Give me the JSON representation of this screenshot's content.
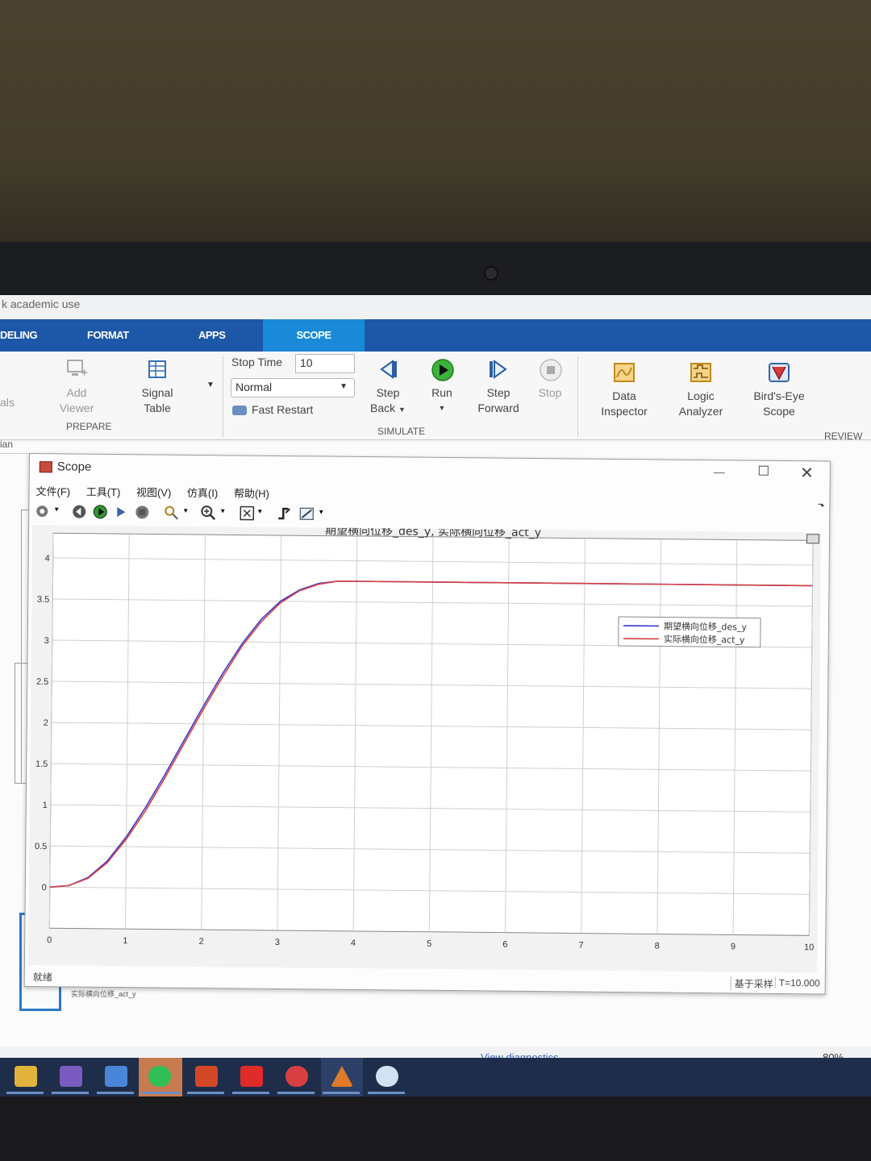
{
  "app": {
    "title_fragment": "k academic use",
    "tabs": [
      "DELING",
      "FORMAT",
      "APPS",
      "SCOPE"
    ],
    "active_tab": "SCOPE",
    "accent_color": "#1d57a8"
  },
  "ribbon": {
    "prepare": {
      "partial_label": "als",
      "add_viewer": [
        "Add",
        "Viewer"
      ],
      "signal_table": [
        "Signal",
        "Table"
      ],
      "group_label": "PREPARE"
    },
    "simulate": {
      "stop_time_label": "Stop Time",
      "stop_time_value": "10",
      "mode_value": "Normal",
      "fast_restart_label": "Fast Restart",
      "step_back": [
        "Step",
        "Back"
      ],
      "run_label": "Run",
      "step_forward": [
        "Step",
        "Forward"
      ],
      "stop_label": "Stop",
      "group_label": "SIMULATE"
    },
    "review": {
      "data_inspector": [
        "Data",
        "Inspector"
      ],
      "logic_analyzer": [
        "Logic",
        "Analyzer"
      ],
      "birds_eye": [
        "Bird's-Eye",
        "Scope"
      ],
      "group_label": "REVIEW R"
    },
    "breadcrumb_fragment": "ian"
  },
  "scope": {
    "window_title": "Scope",
    "menu": [
      "文件(F)",
      "工具(T)",
      "视图(V)",
      "仿真(I)",
      "帮助(H)"
    ],
    "status_left": "就绪",
    "status_sample": "基于采样",
    "status_time": "T=10.000"
  },
  "canvas": {
    "under_label": "实际横向位移_act_y"
  },
  "footer": {
    "view_diagnostics": "View diagnostics",
    "zoom": "80%"
  },
  "taskbar": {
    "icons": [
      "file-explorer-icon",
      "app-icon",
      "network-app-icon",
      "wechat-icon",
      "powerpoint-icon",
      "video-app-icon",
      "car-app-icon",
      "matlab-icon",
      "flower-app-icon"
    ]
  },
  "chart_data": {
    "type": "line",
    "title": "期望横向位移_des_y, 实际横向位移_act_y",
    "xlim": [
      0,
      10
    ],
    "ylim": [
      -0.5,
      4.3
    ],
    "xticks": [
      0,
      1,
      2,
      3,
      4,
      5,
      6,
      7,
      8,
      9,
      10
    ],
    "yticks": [
      0,
      0.5,
      1,
      1.5,
      2,
      2.5,
      3,
      3.5,
      4
    ],
    "legend_position": "upper-right",
    "grid": true,
    "series": [
      {
        "name": "期望横向位移_des_y",
        "color": "#3a3ad0",
        "x": [
          0,
          0.25,
          0.5,
          0.75,
          1,
          1.25,
          1.5,
          1.75,
          2,
          2.25,
          2.5,
          2.75,
          3,
          3.25,
          3.5,
          3.75,
          4,
          5,
          6,
          7,
          8,
          9,
          10
        ],
        "y": [
          0,
          0.02,
          0.12,
          0.32,
          0.62,
          0.98,
          1.38,
          1.8,
          2.22,
          2.62,
          2.98,
          3.28,
          3.5,
          3.64,
          3.72,
          3.75,
          3.75,
          3.75,
          3.75,
          3.75,
          3.75,
          3.75,
          3.75
        ]
      },
      {
        "name": "实际横向位移_act_y",
        "color": "#d84040",
        "x": [
          0,
          0.25,
          0.5,
          0.75,
          1,
          1.25,
          1.5,
          1.75,
          2,
          2.25,
          2.5,
          2.75,
          3,
          3.25,
          3.5,
          3.75,
          4,
          5,
          6,
          7,
          8,
          9,
          10
        ],
        "y": [
          0,
          0.02,
          0.11,
          0.3,
          0.59,
          0.94,
          1.34,
          1.76,
          2.18,
          2.58,
          2.95,
          3.25,
          3.48,
          3.63,
          3.71,
          3.75,
          3.75,
          3.75,
          3.75,
          3.75,
          3.75,
          3.75,
          3.75
        ]
      }
    ]
  }
}
